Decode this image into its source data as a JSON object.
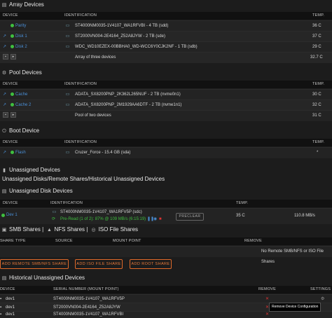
{
  "array": {
    "title": "Array Devices",
    "headers": {
      "device": "DEVICE",
      "identification": "IDENTIFICATION",
      "temp": "TEMP."
    },
    "rows": [
      {
        "device": "Parity",
        "identification": "ST4000NM0035-1V4107_WA1RFVBI - 4 TB (sdd)",
        "temp": "36 C"
      },
      {
        "device": "Disk 1",
        "identification": "ST2000VN004-2E4164_Z52A8JYW - 2 TB (sde)",
        "temp": "37 C"
      },
      {
        "device": "Disk 2",
        "identification": "WDC_WD10EZEX-00BBHA0_WD-WCC6Y0CJK2NF - 1 TB (sdb)",
        "temp": "29 C"
      }
    ],
    "summary": {
      "label": "Array of three devices",
      "temp": "32.7 C"
    }
  },
  "pool": {
    "title": "Pool Devices",
    "headers": {
      "device": "DEVICE",
      "identification": "IDENTIFICATION",
      "temp": "TEMP."
    },
    "rows": [
      {
        "device": "Cache",
        "identification": "ADATA_SX8200PNP_2K362L265NUF - 2 TB (nvme0n1)",
        "temp": "30 C"
      },
      {
        "device": "Cache 2",
        "identification": "ADATA_SX8200PNP_2M1929AA6DTF - 2 TB (nvme1n1)",
        "temp": "32 C"
      }
    ],
    "summary": {
      "label": "Pool of two devices",
      "temp": "31 C"
    }
  },
  "boot": {
    "title": "Boot Device",
    "headers": {
      "device": "DEVICE",
      "identification": "IDENTIFICATION",
      "temp": "TEMP."
    },
    "rows": [
      {
        "device": "Flash",
        "identification": "Cruzer_Force - 15.4 GB (sda)",
        "temp": "*"
      }
    ]
  },
  "unassigned": {
    "title": "Unassigned Devices",
    "subtitle": "Unassigned Disks/Remote Shares/Historical Unassigned Devices",
    "disk_title": "Unassigned Disk Devices",
    "headers": {
      "device": "DEVICE",
      "identification": "IDENTIFICATION",
      "temp": "TEMP.",
      "speed": "SPEED"
    },
    "row": {
      "device": "Dev 1",
      "identification": "ST4000NM0035-1V4107_WA1RFV5P (sdc)",
      "status": "Pre-Read (1 of 2): 87% @ 109 MB/s (6:15:19)",
      "preclear": "PRECLEAR",
      "temp": "35 C",
      "speed": "110.8 MB/s"
    }
  },
  "shares": {
    "smb": "SMB Shares",
    "nfs": "NFS Shares",
    "iso": "ISO File Shares",
    "headers": {
      "share_type": "SHARE TYPE",
      "source": "SOURCE",
      "mount_point": "MOUNT POINT",
      "remove": "REMOVE"
    },
    "empty": "No Remote SMB/NFS or ISO File Shares",
    "buttons": {
      "add_remote": "ADD REMOTE SMB/NFS SHARE",
      "add_iso": "ADD ISO FILE SHARE",
      "add_root": "ADD ROOT SHARE"
    }
  },
  "historical": {
    "title": "Historical Unassigned Devices",
    "headers": {
      "device": "DEVICE",
      "serial": "SERIAL NUMBER (MOUNT POINT)",
      "remove": "REMOVE",
      "settings": "SETTINGS"
    },
    "rows": [
      {
        "device": "dev1",
        "serial": "ST4000NM0035-1V4107_WA1RFV5P"
      },
      {
        "device": "dev1",
        "serial": "ST2000VN004-2E4164_Z52A8JYW"
      },
      {
        "device": "dev1",
        "serial": "ST4000NM0035-1V4107_WA1RFVBI"
      }
    ],
    "tooltip": "Remove Device Configuration"
  },
  "colors": {
    "accent_green": "#3fbf3f",
    "link_blue": "#4a8fd6",
    "orange": "#e06a2a",
    "remove_red": "#d33333"
  }
}
